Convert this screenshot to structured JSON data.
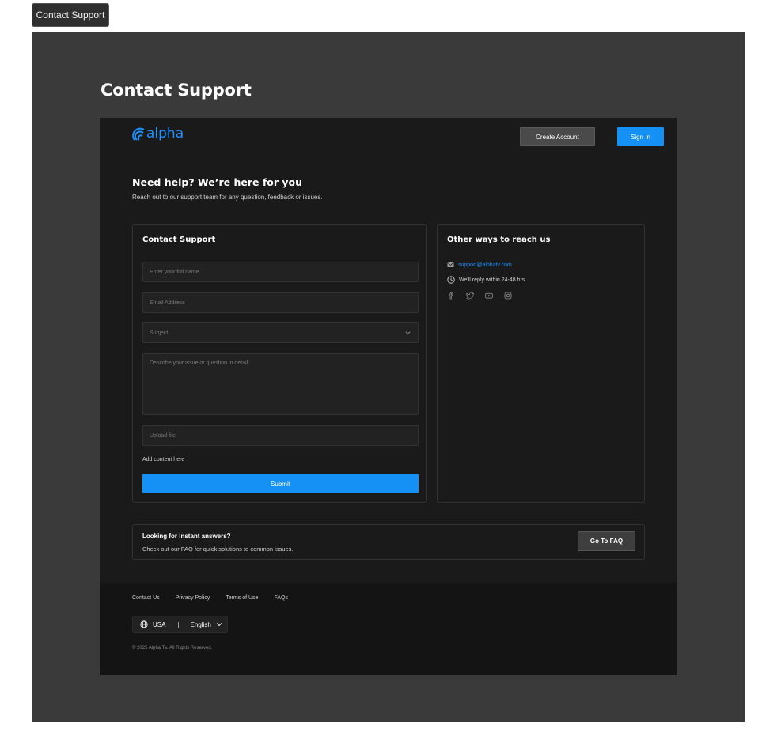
{
  "top_tab": {
    "label": "Contact Support"
  },
  "frame": {
    "title": "Contact Support"
  },
  "header": {
    "logo_text": "alpha",
    "create_account_label": "Create Account",
    "sign_in_label": "Sign In"
  },
  "hero": {
    "title": "Need help? We’re here for you",
    "subtitle": "Reach out to our support team for any question, feedback or issues."
  },
  "form": {
    "title": "Contact Support",
    "name_placeholder": "Enter your full name",
    "email_placeholder": "Email  Address",
    "subject_placeholder": "Subject",
    "message_placeholder": "Describe your issue or question in detail...",
    "upload_placeholder": "Upload file",
    "add_content_label": "Add content here",
    "submit_label": "Submit"
  },
  "other_ways": {
    "title": "Other ways to reach us",
    "email": "support@alphatv.com",
    "reply_time": "We'll reply within 24-48 hrs",
    "social_icons": [
      "facebook-icon",
      "twitter-icon",
      "youtube-icon",
      "instagram-icon"
    ]
  },
  "faq": {
    "title": "Looking for instant answers?",
    "subtitle": "Check out our FAQ for quick solutions to common issues.",
    "button_label": "Go To FAQ"
  },
  "footer": {
    "links": [
      "Contact Us",
      "Privacy Policy",
      "Terms of Use",
      "FAQs"
    ],
    "region": "USA",
    "language": "English",
    "copyright": "© 2025 Alpha Tv. All Rights Reserved."
  },
  "colors": {
    "accent": "#1591f5",
    "frame_bg": "#3a3a3a",
    "app_bg": "#1a1a1a",
    "footer_bg": "#141414"
  }
}
